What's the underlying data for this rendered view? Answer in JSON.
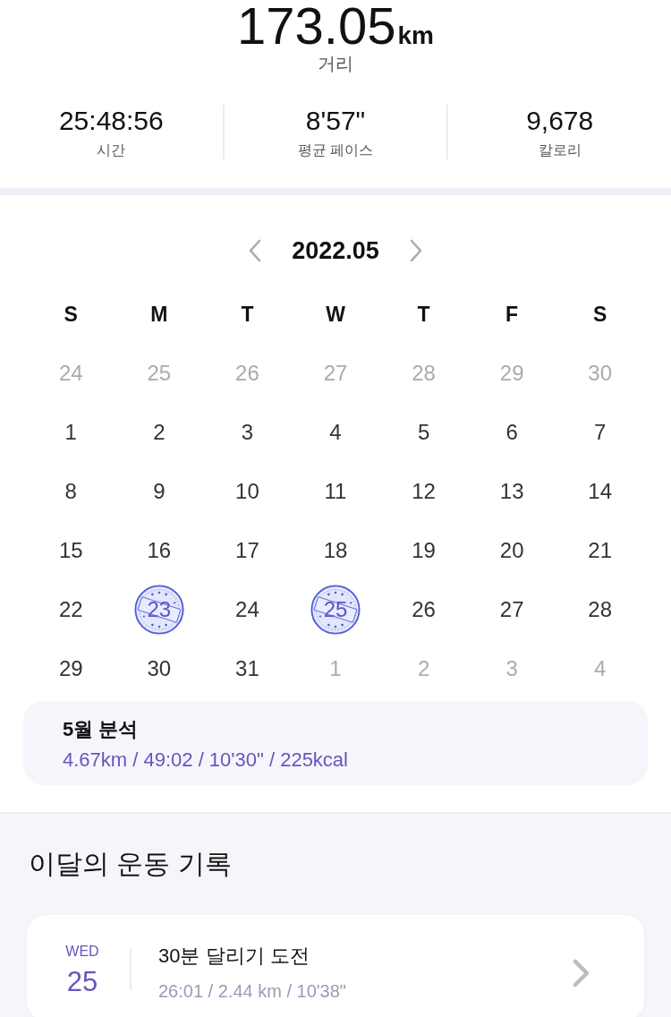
{
  "summary": {
    "distance": {
      "value": "173.05",
      "unit": "km",
      "label": "거리"
    },
    "stats": [
      {
        "value": "25:48:56",
        "label": "시간"
      },
      {
        "value": "8'57\"",
        "label": "평균 페이스"
      },
      {
        "value": "9,678",
        "label": "칼로리"
      }
    ]
  },
  "calendar": {
    "title": "2022.05",
    "weekdays": [
      "S",
      "M",
      "T",
      "W",
      "T",
      "F",
      "S"
    ],
    "weeks": [
      [
        {
          "day": "24",
          "in_month": false,
          "stamped": false
        },
        {
          "day": "25",
          "in_month": false,
          "stamped": false
        },
        {
          "day": "26",
          "in_month": false,
          "stamped": false
        },
        {
          "day": "27",
          "in_month": false,
          "stamped": false
        },
        {
          "day": "28",
          "in_month": false,
          "stamped": false
        },
        {
          "day": "29",
          "in_month": false,
          "stamped": false
        },
        {
          "day": "30",
          "in_month": false,
          "stamped": false
        }
      ],
      [
        {
          "day": "1",
          "in_month": true,
          "stamped": false
        },
        {
          "day": "2",
          "in_month": true,
          "stamped": false
        },
        {
          "day": "3",
          "in_month": true,
          "stamped": false
        },
        {
          "day": "4",
          "in_month": true,
          "stamped": false
        },
        {
          "day": "5",
          "in_month": true,
          "stamped": false
        },
        {
          "day": "6",
          "in_month": true,
          "stamped": false
        },
        {
          "day": "7",
          "in_month": true,
          "stamped": false
        }
      ],
      [
        {
          "day": "8",
          "in_month": true,
          "stamped": false
        },
        {
          "day": "9",
          "in_month": true,
          "stamped": false
        },
        {
          "day": "10",
          "in_month": true,
          "stamped": false
        },
        {
          "day": "11",
          "in_month": true,
          "stamped": false
        },
        {
          "day": "12",
          "in_month": true,
          "stamped": false
        },
        {
          "day": "13",
          "in_month": true,
          "stamped": false
        },
        {
          "day": "14",
          "in_month": true,
          "stamped": false
        }
      ],
      [
        {
          "day": "15",
          "in_month": true,
          "stamped": false
        },
        {
          "day": "16",
          "in_month": true,
          "stamped": false
        },
        {
          "day": "17",
          "in_month": true,
          "stamped": false
        },
        {
          "day": "18",
          "in_month": true,
          "stamped": false
        },
        {
          "day": "19",
          "in_month": true,
          "stamped": false
        },
        {
          "day": "20",
          "in_month": true,
          "stamped": false
        },
        {
          "day": "21",
          "in_month": true,
          "stamped": false
        }
      ],
      [
        {
          "day": "22",
          "in_month": true,
          "stamped": false
        },
        {
          "day": "23",
          "in_month": true,
          "stamped": true
        },
        {
          "day": "24",
          "in_month": true,
          "stamped": false
        },
        {
          "day": "25",
          "in_month": true,
          "stamped": true
        },
        {
          "day": "26",
          "in_month": true,
          "stamped": false
        },
        {
          "day": "27",
          "in_month": true,
          "stamped": false
        },
        {
          "day": "28",
          "in_month": true,
          "stamped": false
        }
      ],
      [
        {
          "day": "29",
          "in_month": true,
          "stamped": false
        },
        {
          "day": "30",
          "in_month": true,
          "stamped": false
        },
        {
          "day": "31",
          "in_month": true,
          "stamped": false
        },
        {
          "day": "1",
          "in_month": false,
          "stamped": false
        },
        {
          "day": "2",
          "in_month": false,
          "stamped": false
        },
        {
          "day": "3",
          "in_month": false,
          "stamped": false
        },
        {
          "day": "4",
          "in_month": false,
          "stamped": false
        }
      ]
    ],
    "analysis": {
      "title": "5월 분석",
      "values": "4.67km / 49:02 / 10'30\" / 225kcal"
    }
  },
  "records": {
    "title": "이달의 운동 기록",
    "items": [
      {
        "weekday": "WED",
        "day": "25",
        "title": "30분 달리기 도전",
        "stats": "26:01 / 2.44 km / 10'38\""
      }
    ]
  }
}
